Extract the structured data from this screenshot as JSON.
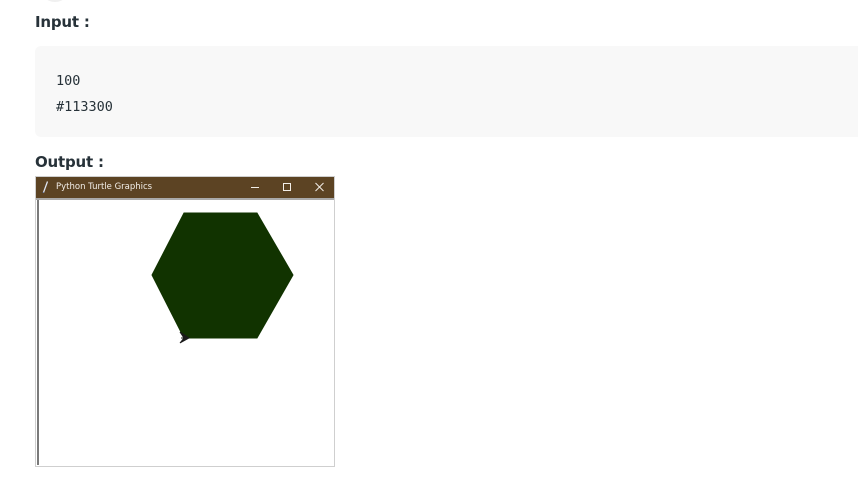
{
  "labels": {
    "input": "Input :",
    "output": "Output :"
  },
  "input_code": {
    "lines": [
      "100",
      "#113300"
    ]
  },
  "turtle_window": {
    "title": "Python Turtle Graphics",
    "titlebar_color": "#5c4323",
    "controls": {
      "minimize": "minimize-icon",
      "maximize": "maximize-icon",
      "close": "close-icon"
    },
    "drawing": {
      "shape": "hexagon",
      "side_length": 100,
      "fill_color": "#113300",
      "cursor_icon": "turtle-arrow-icon"
    }
  }
}
